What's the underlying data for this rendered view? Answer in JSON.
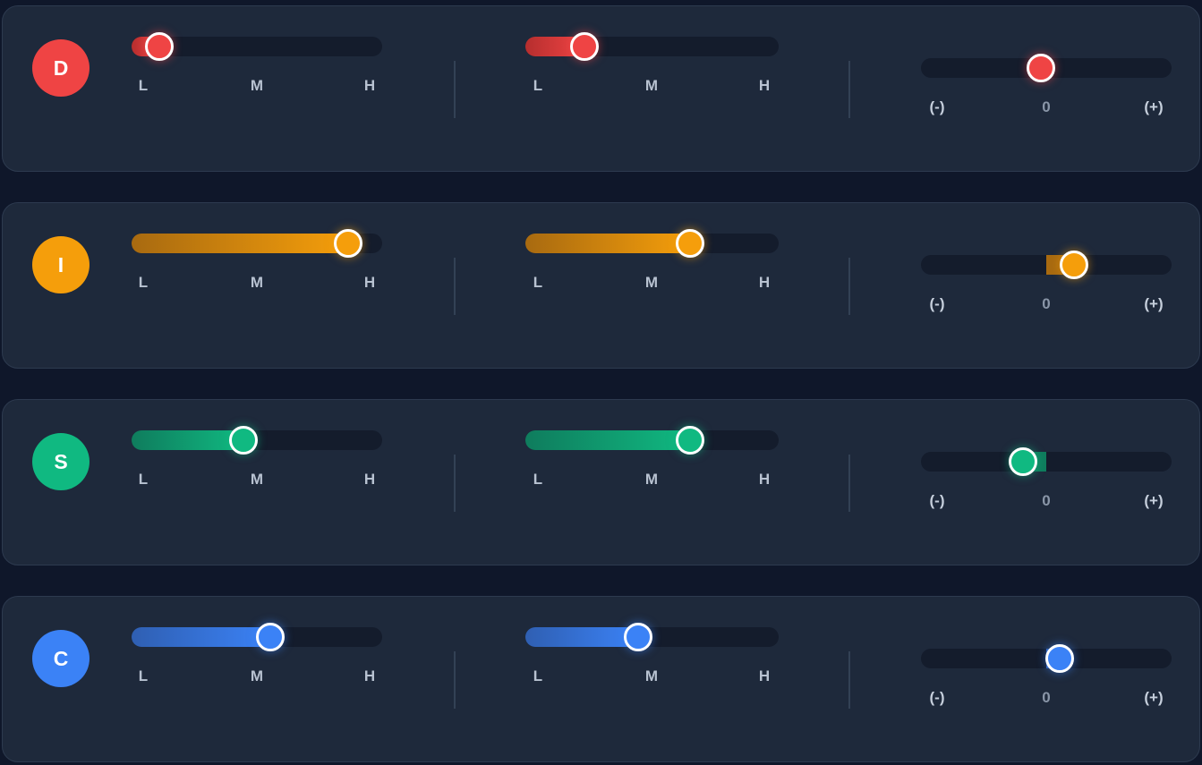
{
  "level_labels": [
    "L",
    "M",
    "H"
  ],
  "bipolar_labels": [
    "(-)",
    "0",
    "(+)"
  ],
  "profiles": [
    {
      "letter": "D",
      "color": "#ef4444",
      "fill_dark": "#b62e2e",
      "slider1": 0.06,
      "slider2": 0.2,
      "bipolar": -0.05
    },
    {
      "letter": "I",
      "color": "#f59e0b",
      "fill_dark": "#a86a10",
      "slider1": 0.91,
      "slider2": 0.67,
      "bipolar": 0.25
    },
    {
      "letter": "S",
      "color": "#10b981",
      "fill_dark": "#0f7c5d",
      "slider1": 0.44,
      "slider2": 0.67,
      "bipolar": -0.21
    },
    {
      "letter": "C",
      "color": "#3b82f6",
      "fill_dark": "#2f5fb2",
      "slider1": 0.56,
      "slider2": 0.44,
      "bipolar": 0.12
    }
  ]
}
